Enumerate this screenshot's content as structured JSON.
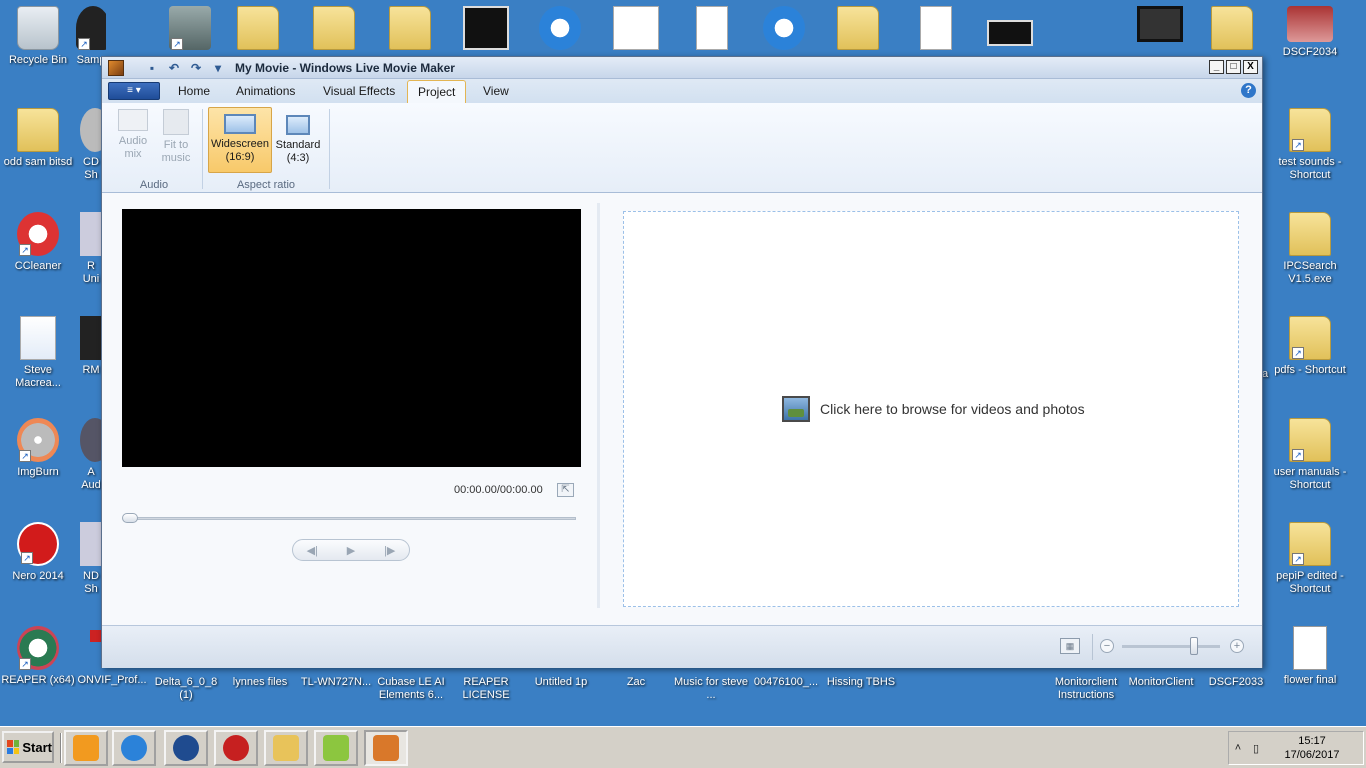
{
  "desktop": {
    "top_row": [
      {
        "label": "Recycle Bin",
        "icon": "recycle-bin-icon"
      },
      {
        "label": "Samp",
        "icon": "hat-icon"
      },
      {
        "label": "",
        "icon": "cabinet-icon"
      },
      {
        "label": "",
        "icon": "folder-icon"
      },
      {
        "label": "",
        "icon": "folder-icon"
      },
      {
        "label": "",
        "icon": "folder-icon"
      },
      {
        "label": "",
        "icon": "video-thumb-icon"
      },
      {
        "label": "",
        "icon": "ie-icon"
      },
      {
        "label": "",
        "icon": "document-icon"
      },
      {
        "label": "",
        "icon": "document-icon"
      },
      {
        "label": "",
        "icon": "ie-icon"
      },
      {
        "label": "",
        "icon": "folder-icon"
      },
      {
        "label": "",
        "icon": "document-icon"
      },
      {
        "label": "",
        "icon": "video-thumb-icon"
      },
      {
        "label": "",
        "icon": "film-icon"
      },
      {
        "label": "",
        "icon": "folder-icon"
      },
      {
        "label": "DSCF2034",
        "icon": "photo-icon"
      }
    ],
    "left_col": [
      {
        "label": "odd sam bitsd",
        "icon": "folder-icon"
      },
      {
        "label": "CCleaner",
        "icon": "ccleaner-icon"
      },
      {
        "label": "Steve Macrea...",
        "icon": "word-doc-icon"
      },
      {
        "label": "ImgBurn",
        "icon": "imgburn-icon"
      },
      {
        "label": "Nero 2014",
        "icon": "nero-icon"
      },
      {
        "label": "REAPER (x64)",
        "icon": "reaper-icon"
      }
    ],
    "second_col": [
      {
        "label": "CD Sh",
        "icon": "cd-icon"
      },
      {
        "label": "R Uni",
        "icon": "installer-icon"
      },
      {
        "label": "RM",
        "icon": "film-icon"
      },
      {
        "label": "A Aud",
        "icon": "audio-icon"
      },
      {
        "label": "ND Sh",
        "icon": "installer-icon"
      },
      {
        "label": "ONVIF_Prof...",
        "icon": "pdf-icon"
      }
    ],
    "right_col": [
      {
        "label": "test sounds - Shortcut",
        "icon": "folder-icon"
      },
      {
        "label": "IPCSearch V1.5.exe",
        "icon": "folder-icon"
      },
      {
        "label": "pdfs - Shortcut",
        "icon": "folder-icon"
      },
      {
        "label": "user manuals - Shortcut",
        "icon": "folder-icon"
      },
      {
        "label": "pepiP edited - Shortcut",
        "icon": "folder-icon"
      },
      {
        "label": "flower final",
        "icon": "wav-icon"
      }
    ],
    "bottom_row": [
      {
        "label": "Delta_6_0_8 (1)",
        "icon": "folder-icon"
      },
      {
        "label": "lynnes files",
        "icon": "folder-icon"
      },
      {
        "label": "TL-WN727N...",
        "icon": "folder-icon"
      },
      {
        "label": "Cubase LE AI Elements 6...",
        "icon": "folder-icon"
      },
      {
        "label": "REAPER LICENSE",
        "icon": "document-icon"
      },
      {
        "label": "Untitled 1p",
        "icon": "document-icon"
      },
      {
        "label": "Zac",
        "icon": "folder-icon"
      },
      {
        "label": "Music for steve ...",
        "icon": "folder-icon"
      },
      {
        "label": "00476100_...",
        "icon": "document-icon"
      },
      {
        "label": "Hissing TBHS",
        "icon": "audio-icon"
      },
      {
        "label": "Monitorclient Instructions",
        "icon": "document-icon"
      },
      {
        "label": "MonitorClient",
        "icon": "app-icon"
      },
      {
        "label": "DSCF2033",
        "icon": "photo-icon"
      }
    ],
    "right_edge_partial": "a"
  },
  "window": {
    "title": "My Movie - Windows Live Movie Maker",
    "controls": {
      "minimize": "_",
      "maximize": "□",
      "close": "X"
    },
    "file_button": "≡ ▾",
    "tabs": [
      "Home",
      "Animations",
      "Visual Effects",
      "Project",
      "View"
    ],
    "active_tab": "Project",
    "help": "?"
  },
  "ribbon": {
    "audio_group": {
      "label": "Audio",
      "audio_mix": "Audio mix",
      "fit_to_music": "Fit to music"
    },
    "aspect_group": {
      "label": "Aspect ratio",
      "widescreen": "Widescreen (16:9)",
      "standard": "Standard (4:3)"
    }
  },
  "player": {
    "timecode": "00:00.00/00:00.00",
    "prev_frame": "◀|",
    "play": "▶",
    "next_frame": "|▶"
  },
  "storyboard": {
    "browse_text": "Click here to browse for videos and photos"
  },
  "statusbar": {
    "zoom_out": "−",
    "zoom_in": "+",
    "zoom_level": 0.7
  },
  "taskbar": {
    "start_label": "Start",
    "apps": [
      {
        "icon": "media-player-icon",
        "color": "#f29a1f"
      },
      {
        "icon": "ie-icon",
        "color": "#2b82d9"
      },
      {
        "icon": "hp-icon",
        "color": "#1f4b8f"
      },
      {
        "icon": "record-icon",
        "color": "#c62020"
      },
      {
        "icon": "explorer-icon",
        "color": "#e8c35a"
      },
      {
        "icon": "android-icon",
        "color": "#8cc63f"
      },
      {
        "icon": "movie-maker-icon",
        "color": "#d9782a"
      }
    ],
    "clock_time": "15:17",
    "clock_date": "17/06/2017"
  }
}
